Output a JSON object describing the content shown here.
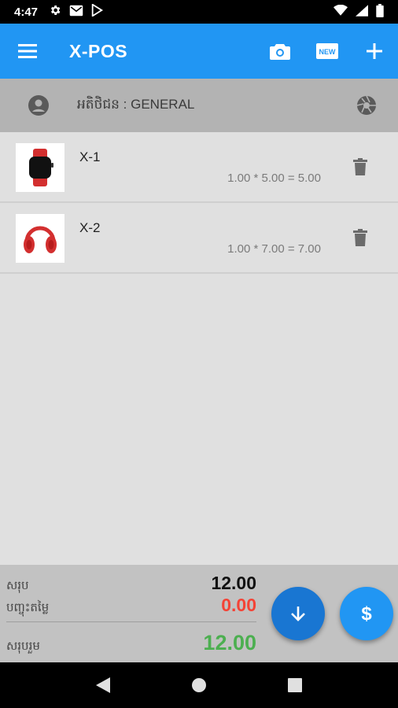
{
  "status_bar": {
    "time": "4:47"
  },
  "app_bar": {
    "title": "X-POS",
    "new_badge": "NEW"
  },
  "customer": {
    "label": "អតិថិជន : GENERAL"
  },
  "items": [
    {
      "name": "X-1",
      "calc": "1.00 * 5.00 = 5.00"
    },
    {
      "name": "X-2",
      "calc": "1.00 * 7.00 = 7.00"
    }
  ],
  "summary": {
    "subtotal_label": "សរុប",
    "subtotal_value": "12.00",
    "discount_label": "បញ្ចុះតម្លៃ",
    "discount_value": "0.00",
    "total_label": "សរុបរួម",
    "total_value": "12.00"
  },
  "colors": {
    "primary": "#2196f3",
    "discount": "#f44336",
    "total": "#4caf50"
  }
}
